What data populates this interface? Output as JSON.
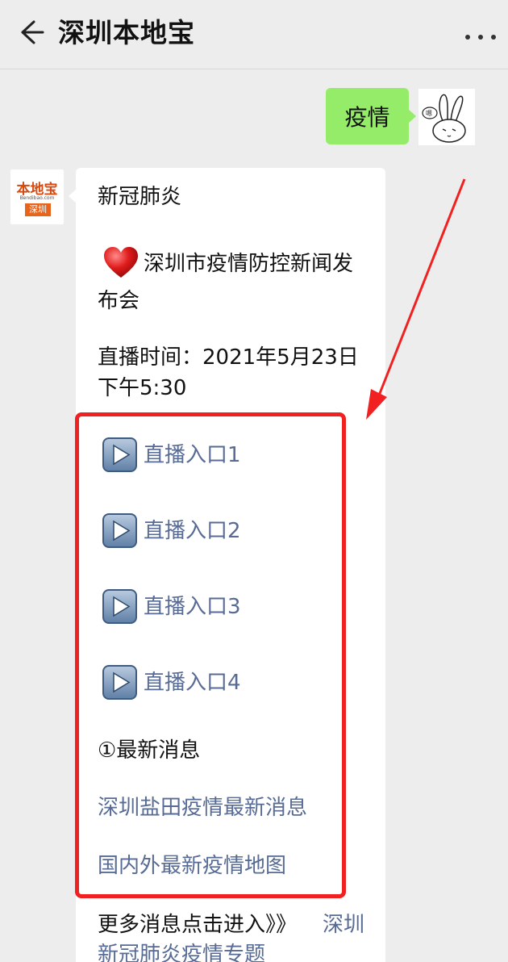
{
  "header": {
    "title": "深圳本地宝"
  },
  "chat": {
    "outgoing": {
      "text": "疫情"
    },
    "brand_avatar": {
      "logo_text": "本地宝",
      "logo_sub": "Bendibao.com",
      "logo_tag": "深圳"
    },
    "incoming": {
      "topic": "新冠肺炎",
      "event_line1": "深圳市疫情防控新闻发",
      "event_line2": "布会",
      "time_line1": "直播时间：2021年5月23日",
      "time_line2": "下午5:30",
      "live_links": [
        "直播入口1",
        "直播入口2",
        "直播入口3",
        "直播入口4"
      ],
      "section_title": "①最新消息",
      "news_links": [
        "深圳盐田疫情最新消息",
        "国内外最新疫情地图"
      ],
      "more_prefix": "更多消息点击进入》》",
      "more_link_line1": "深圳",
      "more_link_line2": "新冠肺炎疫情专题"
    }
  },
  "icons": {
    "back": "arrow-left-icon",
    "more": "more-dots-icon",
    "heart": "heart-icon",
    "play": "play-button-icon"
  },
  "colors": {
    "background": "#ededed",
    "outgoing_bubble": "#95ec69",
    "link": "#576b95",
    "annotation": "#f22121",
    "brand_orange": "#e8641b"
  }
}
